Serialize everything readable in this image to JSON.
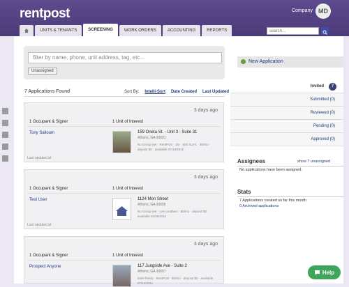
{
  "app": {
    "logo": "rentpost",
    "company": "Company",
    "avatar": "MD"
  },
  "nav": {
    "tabs": [
      "UNITS & TENANTS",
      "SCREENING",
      "WORK ORDERS",
      "ACCOUNTING",
      "REPORTS"
    ],
    "search_placeholder": "search..."
  },
  "filter": {
    "placeholder": "filter by name, phone, unit address, tag, etc...",
    "tag": "Unassigned"
  },
  "list": {
    "found": "7 Applications Found",
    "sort_label": "Sort By:",
    "sort_options": [
      "Intelli-Sort",
      "Date Created",
      "Last Updated"
    ]
  },
  "cards": [
    {
      "ago": "3 days ago",
      "occ_hdr": "1 Occupant & Signer",
      "unit_hdr": "1 Unit of Interest",
      "person": "Tony Salloum",
      "addr": "159 Oneta St. - Unit 3 - Suite 31",
      "city": "Athens, GA 30601",
      "info": "No Group Set · RentPost · 1br · 800 Sq.Ft. · $0/mo · deposit $0 · available 07/19/2010",
      "updated": "Last updated at"
    },
    {
      "ago": "3 days ago",
      "occ_hdr": "1 Occupant & Signer",
      "unit_hdr": "1 Unit of Interest",
      "person": "Test User",
      "addr": "1124 Mon Street",
      "city": "Athens, GA 30605",
      "info": "No Group Set · Lee Leathers · $0/mo · deposit $0 · available 01/08/2011",
      "updated": "Last updated at"
    },
    {
      "ago": "3 days ago",
      "occ_hdr": "1 Occupant & Signer",
      "unit_hdr": "1 Unit of Interest",
      "person": "Prospect Anyone",
      "addr": "117 Jungside Ave - Suite 2",
      "city": "Athens, GA 30607",
      "info": "Multi-family · RentPost · $0/mo · deposit $0 · available 07/12/2011",
      "updated": ""
    }
  ],
  "sidebar": {
    "new_app": "New Application",
    "statuses": [
      {
        "label": "Invited",
        "count": "7"
      },
      {
        "label": "Submitted (0)"
      },
      {
        "label": "Reviewed (0)"
      },
      {
        "label": "Pending (0)"
      },
      {
        "label": "Approved (0)"
      }
    ],
    "assignees_title": "Assignees",
    "show_unassigned": "show 7 unassigned",
    "assignees_note": "No applications have been assigned.",
    "stats_title": "Stats",
    "stats_line1": "7 Applications created so far this month",
    "stats_line2": "0 Archived applications"
  },
  "help": "Help"
}
